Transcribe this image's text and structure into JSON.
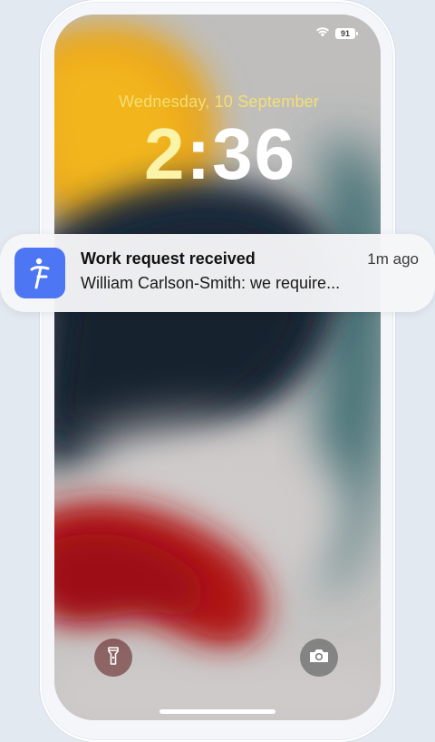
{
  "status_bar": {
    "battery_level": "91",
    "wifi_icon": "wifi-icon"
  },
  "lock_screen": {
    "date": "Wednesday, 10 September",
    "time_hour": "2",
    "time_rest": ":36"
  },
  "notification": {
    "app_icon": "app-logo-icon",
    "title": "Work request received",
    "time_ago": "1m ago",
    "body": "William Carlson-Smith: we require..."
  },
  "quick_actions": {
    "flashlight_icon": "flashlight-icon",
    "camera_icon": "camera-icon"
  },
  "colors": {
    "app_icon_bg": "#4d76f4",
    "date_color": "#f4df73",
    "time_color": "#fbf3a7"
  }
}
